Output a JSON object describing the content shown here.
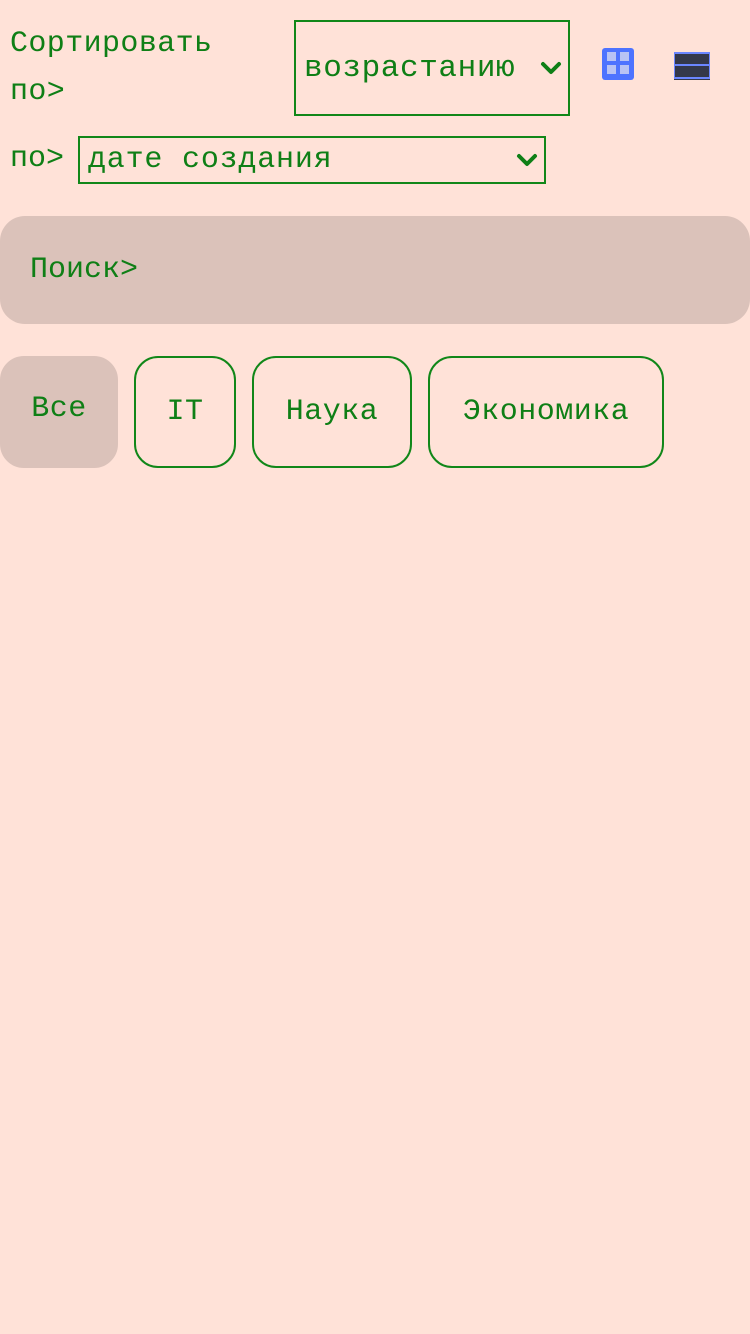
{
  "sort": {
    "label_line_1": "Сортировать",
    "label_line_2": "по>",
    "order_value": "возрастанию",
    "field_prefix": "по>",
    "field_value": "дате создания"
  },
  "view_controls": {
    "grid_icon": "grid-view-icon",
    "list_icon": "list-view-icon",
    "colors": {
      "grid": "#4d73ff",
      "list_bar": "#34384a",
      "list_accent": "#6b86ff"
    }
  },
  "search": {
    "placeholder": "Поиск>"
  },
  "categories": [
    {
      "label": "Все",
      "active": true
    },
    {
      "label": "IT",
      "active": false
    },
    {
      "label": "Наука",
      "active": false
    },
    {
      "label": "Экономика",
      "active": false
    }
  ],
  "theme": {
    "background": "#ffe2d8",
    "text": "#0f7f16",
    "surface": "#dbc2ba"
  }
}
